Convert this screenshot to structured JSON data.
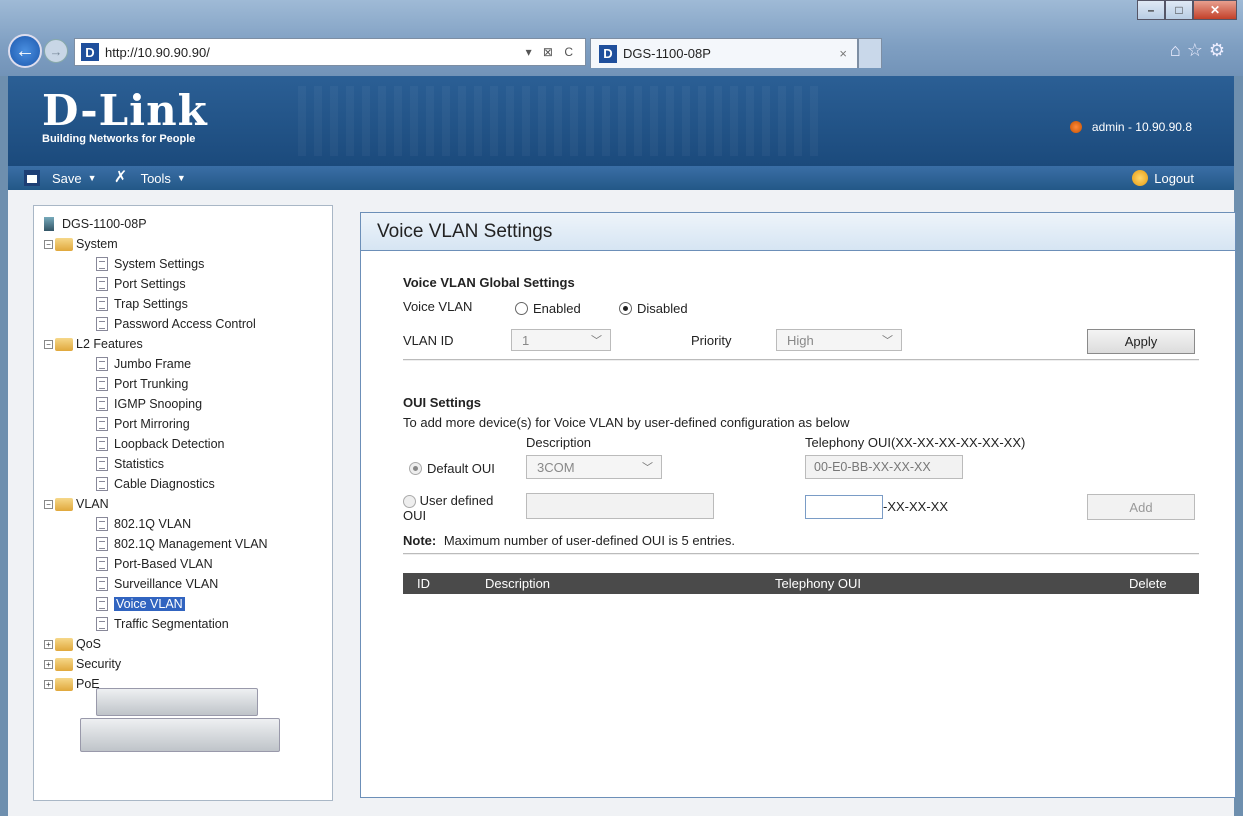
{
  "browser": {
    "url": "http://10.90.90.90/",
    "tab_title": "DGS-1100-08P",
    "tab_close": "×",
    "back": "←",
    "forward": "→",
    "addr_controls": "▾ ⊠ C"
  },
  "header": {
    "brand": "D-Link",
    "tagline": "Building Networks for People",
    "user": "admin - 10.90.90.8"
  },
  "menubar": {
    "save": "Save",
    "tools": "Tools",
    "logout": "Logout"
  },
  "tree": {
    "root": "DGS-1100-08P",
    "groups": [
      {
        "label": "System",
        "expanded": true,
        "items": [
          "System Settings",
          "Port Settings",
          "Trap Settings",
          "Password Access Control"
        ]
      },
      {
        "label": "L2 Features",
        "expanded": true,
        "items": [
          "Jumbo Frame",
          "Port Trunking",
          "IGMP Snooping",
          "Port Mirroring",
          "Loopback Detection",
          "Statistics",
          "Cable Diagnostics"
        ]
      },
      {
        "label": "VLAN",
        "expanded": true,
        "items": [
          "802.1Q VLAN",
          "802.1Q Management VLAN",
          "Port-Based VLAN",
          "Surveillance VLAN",
          "Voice VLAN",
          "Traffic Segmentation"
        ]
      },
      {
        "label": "QoS",
        "expanded": false,
        "items": []
      },
      {
        "label": "Security",
        "expanded": false,
        "items": []
      },
      {
        "label": "PoE",
        "expanded": false,
        "items": []
      }
    ],
    "selected": "Voice VLAN"
  },
  "page": {
    "title": "Voice VLAN Settings",
    "global": {
      "heading": "Voice VLAN Global Settings",
      "voice_vlan_label": "Voice VLAN",
      "enabled_label": "Enabled",
      "disabled_label": "Disabled",
      "selected": "Disabled",
      "vlan_id_label": "VLAN ID",
      "vlan_id_value": "1",
      "priority_label": "Priority",
      "priority_value": "High",
      "apply_label": "Apply"
    },
    "oui": {
      "heading": "OUI Settings",
      "intro": "To add more device(s) for Voice VLAN by user-defined configuration as below",
      "description_col": "Description",
      "telephony_col": "Telephony OUI(XX-XX-XX-XX-XX-XX)",
      "default_oui_label": "Default OUI",
      "default_description": "3COM",
      "default_telephony": "00-E0-BB-XX-XX-XX",
      "user_defined_label_1": "User defined",
      "user_defined_label_2": "OUI",
      "user_description": "",
      "user_telephony": "",
      "user_suffix": "-XX-XX-XX",
      "add_label": "Add",
      "note_label": "Note:",
      "note_text": "Maximum number of user-defined OUI is 5 entries."
    },
    "table": {
      "columns": [
        "ID",
        "Description",
        "Telephony OUI",
        "Delete"
      ],
      "rows": []
    }
  }
}
